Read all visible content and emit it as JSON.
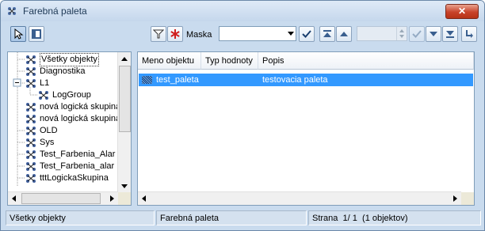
{
  "window": {
    "title": "Farebná paleta",
    "close_symbol": "✕"
  },
  "toolbar": {
    "mask_label": "Maska",
    "mask_value": ""
  },
  "tree": {
    "items": [
      {
        "label": "Všetky objekty",
        "indent": 0,
        "selected": true
      },
      {
        "label": "Diagnostika",
        "indent": 0
      },
      {
        "label": "L1",
        "indent": 0,
        "expanded": true
      },
      {
        "label": "LogGroup",
        "indent": 1
      },
      {
        "label": "nová logická skupina",
        "indent": 0
      },
      {
        "label": "nová logická skupina",
        "indent": 0
      },
      {
        "label": "OLD",
        "indent": 0
      },
      {
        "label": "Sys",
        "indent": 0
      },
      {
        "label": "Test_Farbenia_Alar",
        "indent": 0
      },
      {
        "label": "Test_Farbenia_alar",
        "indent": 0
      },
      {
        "label": "tttLogickaSkupina",
        "indent": 0
      }
    ]
  },
  "grid": {
    "columns": [
      "Meno objektu",
      "Typ hodnoty",
      "Popis"
    ],
    "rows": [
      {
        "name": "test_paleta",
        "type": "",
        "description": "testovacia paleta"
      }
    ]
  },
  "status": {
    "left": "Všetky objekty",
    "middle": "Farebná paleta",
    "page_label": "Strana",
    "page": "1/ 1",
    "count": "(1 objektov)"
  }
}
